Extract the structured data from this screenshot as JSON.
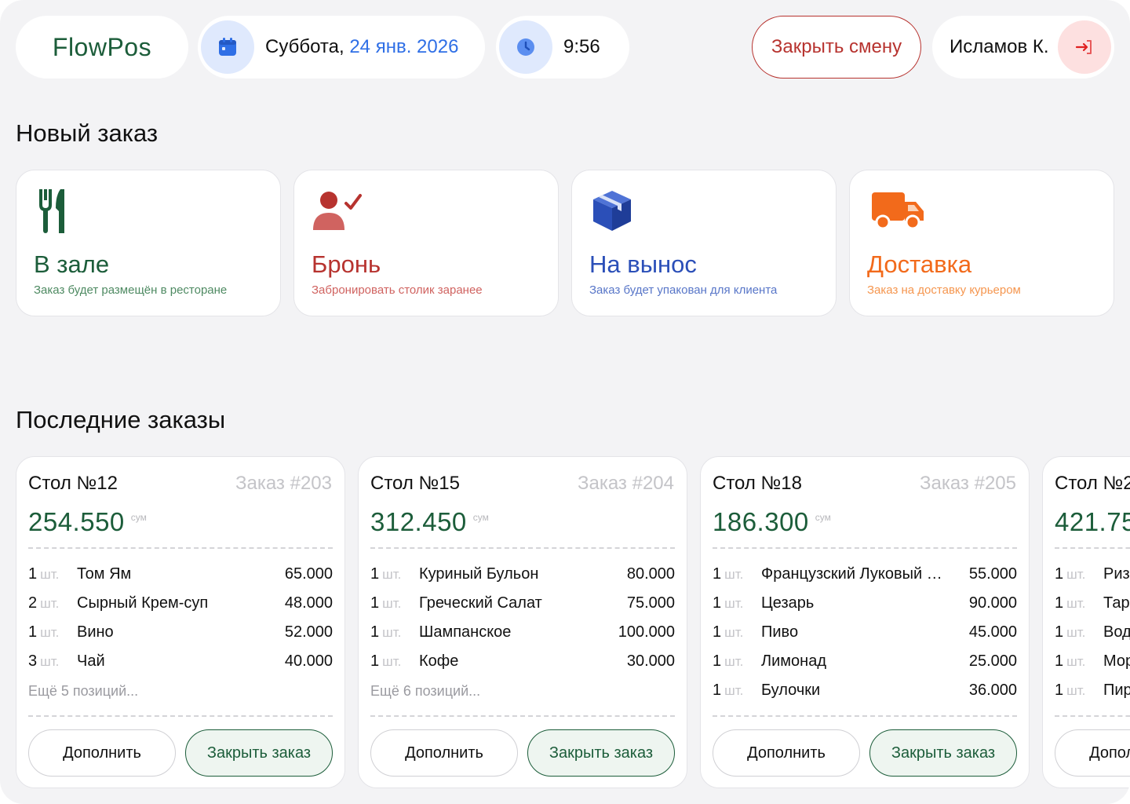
{
  "header": {
    "logo": "FlowPos",
    "date_weekday": "Суббота,",
    "date_value": "24 янв. 2026",
    "time": "9:56",
    "close_shift_label": "Закрыть смену",
    "user_name": "Исламов К."
  },
  "new_order": {
    "title": "Новый заказ",
    "types": [
      {
        "title": "В зале",
        "subtitle": "Заказ будет размещён в ресторане",
        "color": "#1c5d3a",
        "sub_color": "#4e8a62",
        "icon": "fork-knife-icon"
      },
      {
        "title": "Бронь",
        "subtitle": "Забронировать столик заранее",
        "color": "#b7332f",
        "sub_color": "#d06360",
        "icon": "person-check-icon"
      },
      {
        "title": "На вынос",
        "subtitle": "Заказ будет упакован для клиента",
        "color": "#2b4fb8",
        "sub_color": "#5876c8",
        "icon": "box-icon"
      },
      {
        "title": "Доставка",
        "subtitle": "Заказ на доставку курьером",
        "color": "#f26a1b",
        "sub_color": "#f5964f",
        "icon": "truck-icon"
      }
    ]
  },
  "recent": {
    "title": "Последние заказы",
    "currency": "сум",
    "unit": "шт.",
    "add_label": "Дополнить",
    "close_label": "Закрыть заказ",
    "orders": [
      {
        "table": "Стол №12",
        "number": "Заказ #203",
        "total": "254.550",
        "items": [
          {
            "qty": "1",
            "name": "Том Ям",
            "price": "65.000"
          },
          {
            "qty": "2",
            "name": "Сырный Крем-суп",
            "price": "48.000"
          },
          {
            "qty": "1",
            "name": "Вино",
            "price": "52.000"
          },
          {
            "qty": "3",
            "name": "Чай",
            "price": "40.000"
          }
        ],
        "more": "Ещё 5 позиций..."
      },
      {
        "table": "Стол №15",
        "number": "Заказ #204",
        "total": "312.450",
        "items": [
          {
            "qty": "1",
            "name": "Куриный Бульон",
            "price": "80.000"
          },
          {
            "qty": "1",
            "name": "Греческий Салат",
            "price": "75.000"
          },
          {
            "qty": "1",
            "name": "Шампанское",
            "price": "100.000"
          },
          {
            "qty": "1",
            "name": "Кофе",
            "price": "30.000"
          }
        ],
        "more": "Ещё 6 позиций..."
      },
      {
        "table": "Стол №18",
        "number": "Заказ #205",
        "total": "186.300",
        "items": [
          {
            "qty": "1",
            "name": "Французский Луковый Суп",
            "price": "55.000"
          },
          {
            "qty": "1",
            "name": "Цезарь",
            "price": "90.000"
          },
          {
            "qty": "1",
            "name": "Пиво",
            "price": "45.000"
          },
          {
            "qty": "1",
            "name": "Лимонад",
            "price": "25.000"
          },
          {
            "qty": "1",
            "name": "Булочки",
            "price": "36.000"
          }
        ],
        "more": ""
      },
      {
        "table": "Стол №2",
        "number": "",
        "total": "421.75",
        "items": [
          {
            "qty": "1",
            "name": "Риз",
            "price": ""
          },
          {
            "qty": "1",
            "name": "Тар",
            "price": ""
          },
          {
            "qty": "1",
            "name": "Вод",
            "price": ""
          },
          {
            "qty": "1",
            "name": "Мор",
            "price": ""
          },
          {
            "qty": "1",
            "name": "Пир",
            "price": ""
          }
        ],
        "more": ""
      }
    ]
  }
}
